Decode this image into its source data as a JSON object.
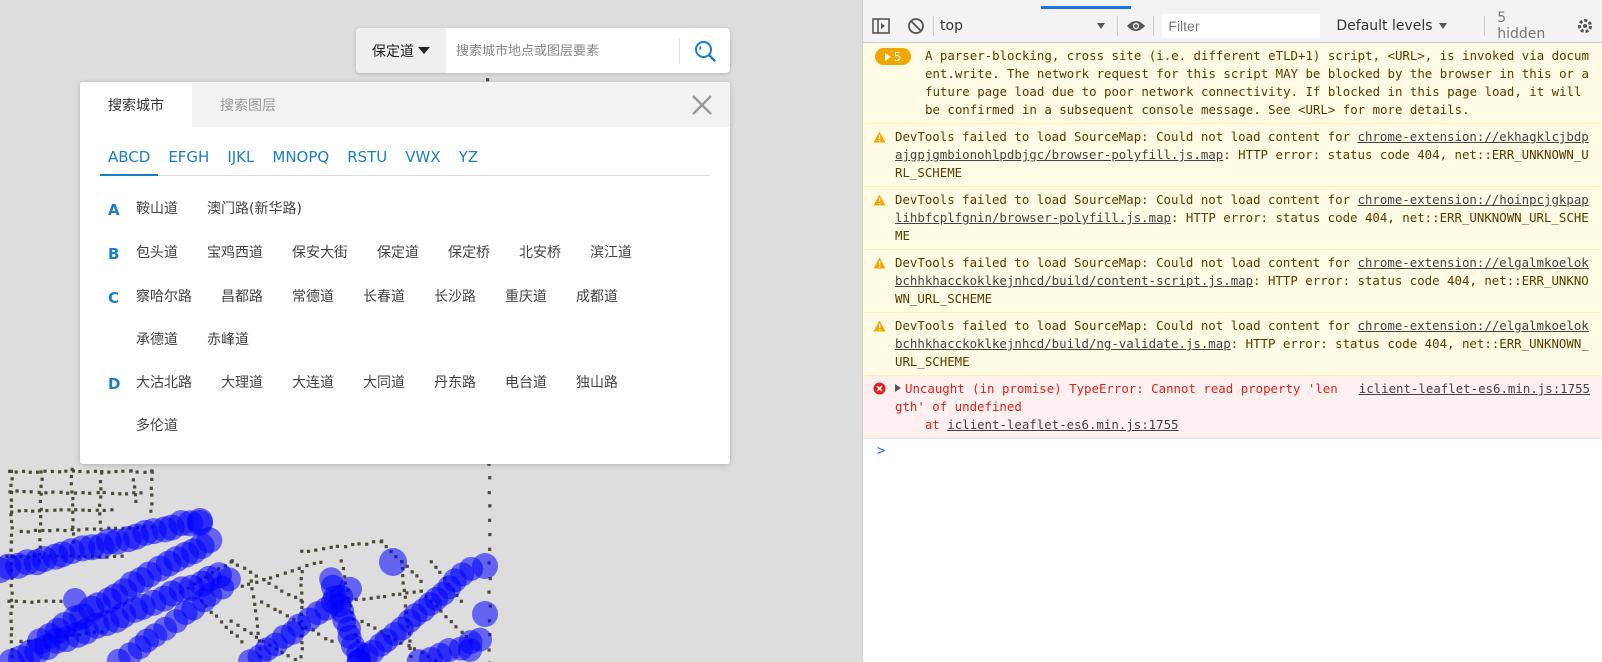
{
  "search": {
    "city": "保定道",
    "placeholder": "搜索城市地点或图层要素"
  },
  "panel": {
    "tabs": [
      "搜索城市",
      "搜索图层"
    ],
    "letter_tabs": [
      "ABCD",
      "EFGH",
      "IJKL",
      "MNOPQ",
      "RSTU",
      "VWX",
      "YZ"
    ],
    "groups": [
      {
        "letter": "A",
        "cities": [
          "鞍山道",
          "澳门路(新华路)"
        ]
      },
      {
        "letter": "B",
        "cities": [
          "包头道",
          "宝鸡西道",
          "保安大街",
          "保定道",
          "保定桥",
          "北安桥",
          "滨江道"
        ]
      },
      {
        "letter": "C",
        "cities": [
          "察哈尔路",
          "昌都路",
          "常德道",
          "长春道",
          "长沙路",
          "重庆道",
          "成都道",
          "承德道",
          "赤峰道"
        ]
      },
      {
        "letter": "D",
        "cities": [
          "大沽北路",
          "大理道",
          "大连道",
          "大同道",
          "丹东路",
          "电台道",
          "独山路",
          "多伦道"
        ]
      }
    ]
  },
  "devtools": {
    "context": "top",
    "filter_placeholder": "Filter",
    "levels": "Default levels",
    "hidden": "5 hidden",
    "grouped_count": "5",
    "messages": [
      {
        "type": "grouped",
        "text": "A parser-blocking, cross site (i.e. different eTLD+1) script, <URL>, is invoked via document.write. The network request for this script MAY be blocked by the browser in this or a future page load due to poor network connectivity. If blocked in this page load, it will be confirmed in a subsequent console message. See <URL> for more details."
      },
      {
        "type": "warn",
        "prefix": "DevTools failed to load SourceMap: Could not load content for ",
        "link": "chrome-extension://ekhagklcjbdpajgpjgmbionohlpdbjgc/browser-polyfill.js.map",
        "suffix": ": HTTP error: status code 404, net::ERR_UNKNOWN_URL_SCHEME"
      },
      {
        "type": "warn",
        "prefix": "DevTools failed to load SourceMap: Could not load content for ",
        "link": "chrome-extension://hoinpcjgkpaplihbfcplfgnin/browser-polyfill.js.map",
        "suffix": ": HTTP error: status code 404, net::ERR_UNKNOWN_URL_SCHEME"
      },
      {
        "type": "warn",
        "prefix": "DevTools failed to load SourceMap: Could not load content for ",
        "link": "chrome-extension://elgalmkoelokbchhkhacckoklkejnhcd/build/content-script.js.map",
        "suffix": ": HTTP error: status code 404, net::ERR_UNKNOWN_URL_SCHEME"
      },
      {
        "type": "warn",
        "prefix": "DevTools failed to load SourceMap: Could not load content for ",
        "link": "chrome-extension://elgalmkoelokbchhkhacckoklkejnhcd/build/ng-validate.js.map",
        "suffix": ": HTTP error: status code 404, net::ERR_UNKNOWN_URL_SCHEME"
      }
    ],
    "error": {
      "text": "Uncaught (in promise) TypeError: Cannot read property 'length' of undefined",
      "at": "    at ",
      "source": "iclient-leaflet-es6.min.js:1755"
    },
    "prompt": ">"
  },
  "colors": {
    "accent": "#1a7ec9",
    "map_background": "#dddddd",
    "map_points": "#0000ff",
    "road_dots": "#4d4a3a",
    "warning_bg": "#fffbe5",
    "error_bg": "#fff0f0"
  }
}
